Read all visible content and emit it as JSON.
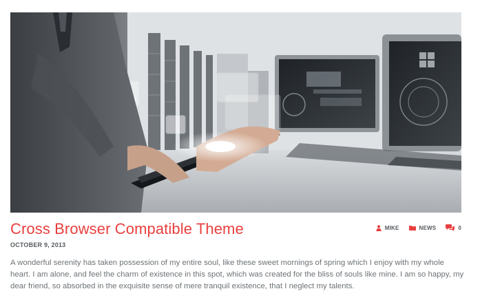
{
  "post": {
    "title": "Cross Browser Compatible Theme",
    "date": "OCTOBER 9, 2013",
    "excerpt": "A wonderful serenity has taken possession of my entire soul, like these sweet mornings of spring which I enjoy with my whole heart. I am alone, and feel the charm of existence in this spot, which was created for the bliss of souls like mine. I am so happy, my dear friend, so absorbed in the exquisite sense of mere tranquil existence, that I neglect my talents.",
    "featured_image": {
      "icon": "featured-image"
    }
  },
  "meta": {
    "author": {
      "label": "MIKE",
      "icon": "user-icon"
    },
    "category": {
      "label": "NEWS",
      "icon": "folder-icon"
    },
    "comments": {
      "label": "0",
      "icon": "comments-icon"
    }
  },
  "colors": {
    "accent": "#e8403f",
    "meta_text": "#555a5f",
    "body_text": "#6d7276"
  }
}
